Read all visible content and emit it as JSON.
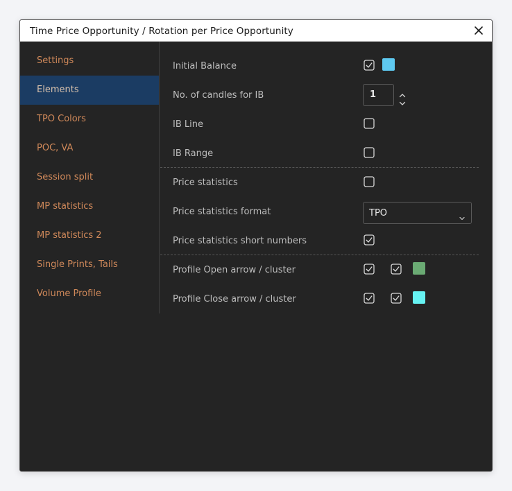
{
  "dialog": {
    "title": "Time Price Opportunity / Rotation per Price Opportunity"
  },
  "sidebar": {
    "items": [
      {
        "label": "Settings",
        "active": false
      },
      {
        "label": "Elements",
        "active": true
      },
      {
        "label": "TPO Colors",
        "active": false
      },
      {
        "label": "POC, VA",
        "active": false
      },
      {
        "label": "Session split",
        "active": false
      },
      {
        "label": "MP statistics",
        "active": false
      },
      {
        "label": "MP statistics 2",
        "active": false
      },
      {
        "label": "Single Prints, Tails",
        "active": false
      },
      {
        "label": "Volume Profile",
        "active": false
      }
    ]
  },
  "elements": {
    "initial_balance": {
      "label": "Initial Balance",
      "checked": true,
      "color": "#5ec9f0"
    },
    "ib_candles": {
      "label": "No. of candles for IB",
      "value": "1"
    },
    "ib_line": {
      "label": "IB Line",
      "checked": false
    },
    "ib_range": {
      "label": "IB Range",
      "checked": false
    },
    "price_statistics": {
      "label": "Price statistics",
      "checked": false
    },
    "price_statistics_format": {
      "label": "Price statistics format",
      "value": "TPO"
    },
    "price_statistics_short": {
      "label": "Price statistics short numbers",
      "checked": true
    },
    "profile_open": {
      "label": "Profile Open arrow / cluster",
      "arrow_checked": true,
      "cluster_checked": true,
      "color": "#6aaa73"
    },
    "profile_close": {
      "label": "Profile Close arrow / cluster",
      "arrow_checked": true,
      "cluster_checked": true,
      "color": "#66f2f2"
    }
  },
  "colors": {
    "accent_text": "#d0895a",
    "active_item_bg": "#1b3c63",
    "panel_bg": "#242424"
  }
}
